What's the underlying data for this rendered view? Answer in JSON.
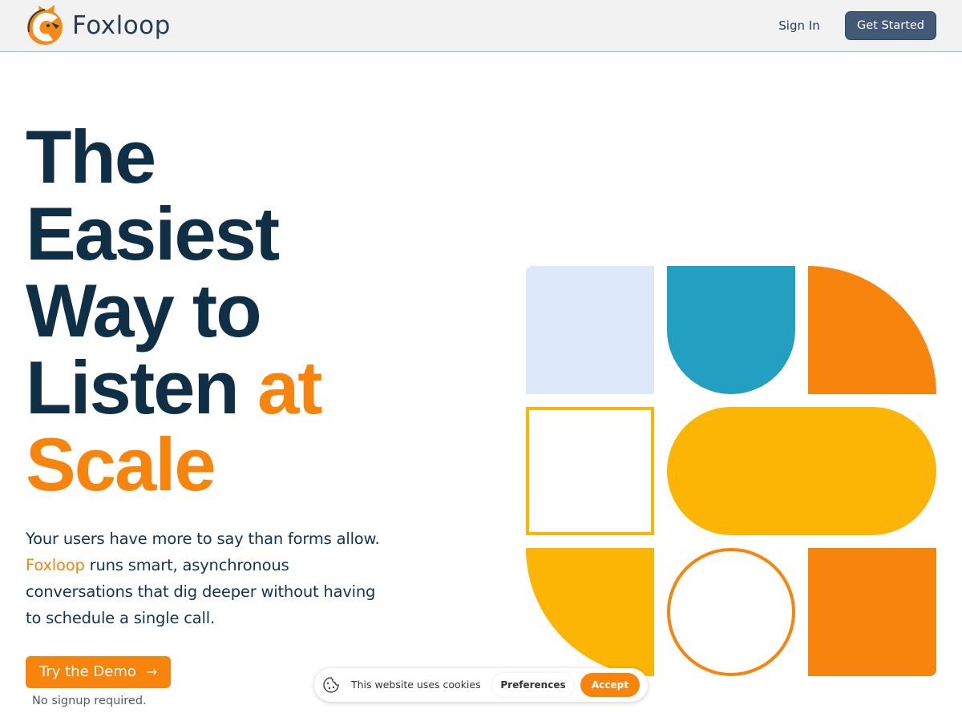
{
  "header": {
    "brand_name": "Foxloop",
    "logo_icon": "fox-logo-icon",
    "sign_in_label": "Sign In",
    "get_started_label": "Get Started"
  },
  "hero": {
    "title_lines": [
      "The",
      "Easiest",
      "Way to",
      "Listen"
    ],
    "title_accent_inline": "at",
    "title_accent_line": "Scale",
    "subtitle_intro": "Your users have more to say than forms allow.",
    "subtitle_brand": "Foxloop",
    "subtitle_rest": " runs smart, asynchronous conversations that dig deeper without having to schedule a single call.",
    "cta_label": "Try the Demo",
    "cta_icon": "arrow-right-icon",
    "cta_note": "No signup required."
  },
  "cookie_banner": {
    "icon": "cookie-icon",
    "text": "This website uses cookies",
    "preferences_label": "Preferences",
    "accept_label": "Accept"
  },
  "colors": {
    "accent_orange": "#f7840c",
    "dark_navy": "#0e2f46",
    "button_slate": "#435a76",
    "light_blue": "#dce9fb",
    "teal": "#239fc2",
    "yellow": "#fcb504",
    "header_bg": "#f2f2f3"
  }
}
